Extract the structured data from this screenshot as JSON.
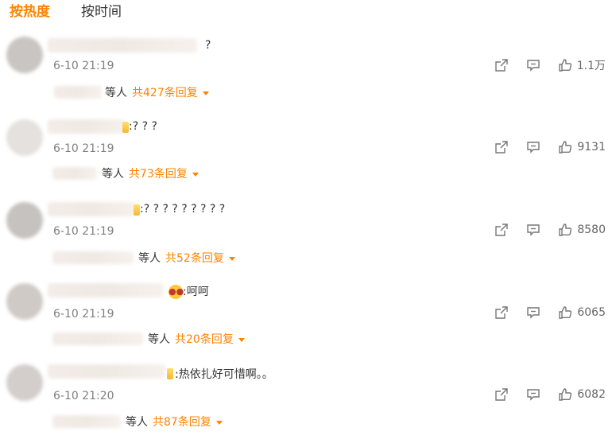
{
  "tabs": {
    "hot": "按热度",
    "time": "按时间"
  },
  "comments": [
    {
      "text": "?",
      "time": "6-10 21:19",
      "likes": "1.1万",
      "reply_who": "等人",
      "reply_total": "共427条回复"
    },
    {
      "text": ":? ? ?",
      "time": "6-10 21:19",
      "likes": "9131",
      "reply_who": "等人",
      "reply_total": "共73条回复"
    },
    {
      "text": ":? ? ? ? ? ? ? ? ?",
      "time": "6-10 21:19",
      "likes": "8580",
      "reply_who": "等人",
      "reply_total": "共52条回复"
    },
    {
      "text": ":呵呵",
      "time": "6-10 21:19",
      "likes": "6065",
      "reply_who": "等人",
      "reply_total": "共20条回复"
    },
    {
      "text": ":热依扎好可惜啊。。",
      "time": "6-10 21:20",
      "likes": "6082",
      "reply_who": "等人",
      "reply_total": "共87条回复"
    }
  ],
  "icons": {
    "share": "share-icon",
    "comment": "comment-icon",
    "like": "thumbs-up-icon",
    "more": "chevron-down-icon"
  },
  "colors": {
    "accent": "#ff8200",
    "text": "#333333",
    "muted": "#808080"
  }
}
